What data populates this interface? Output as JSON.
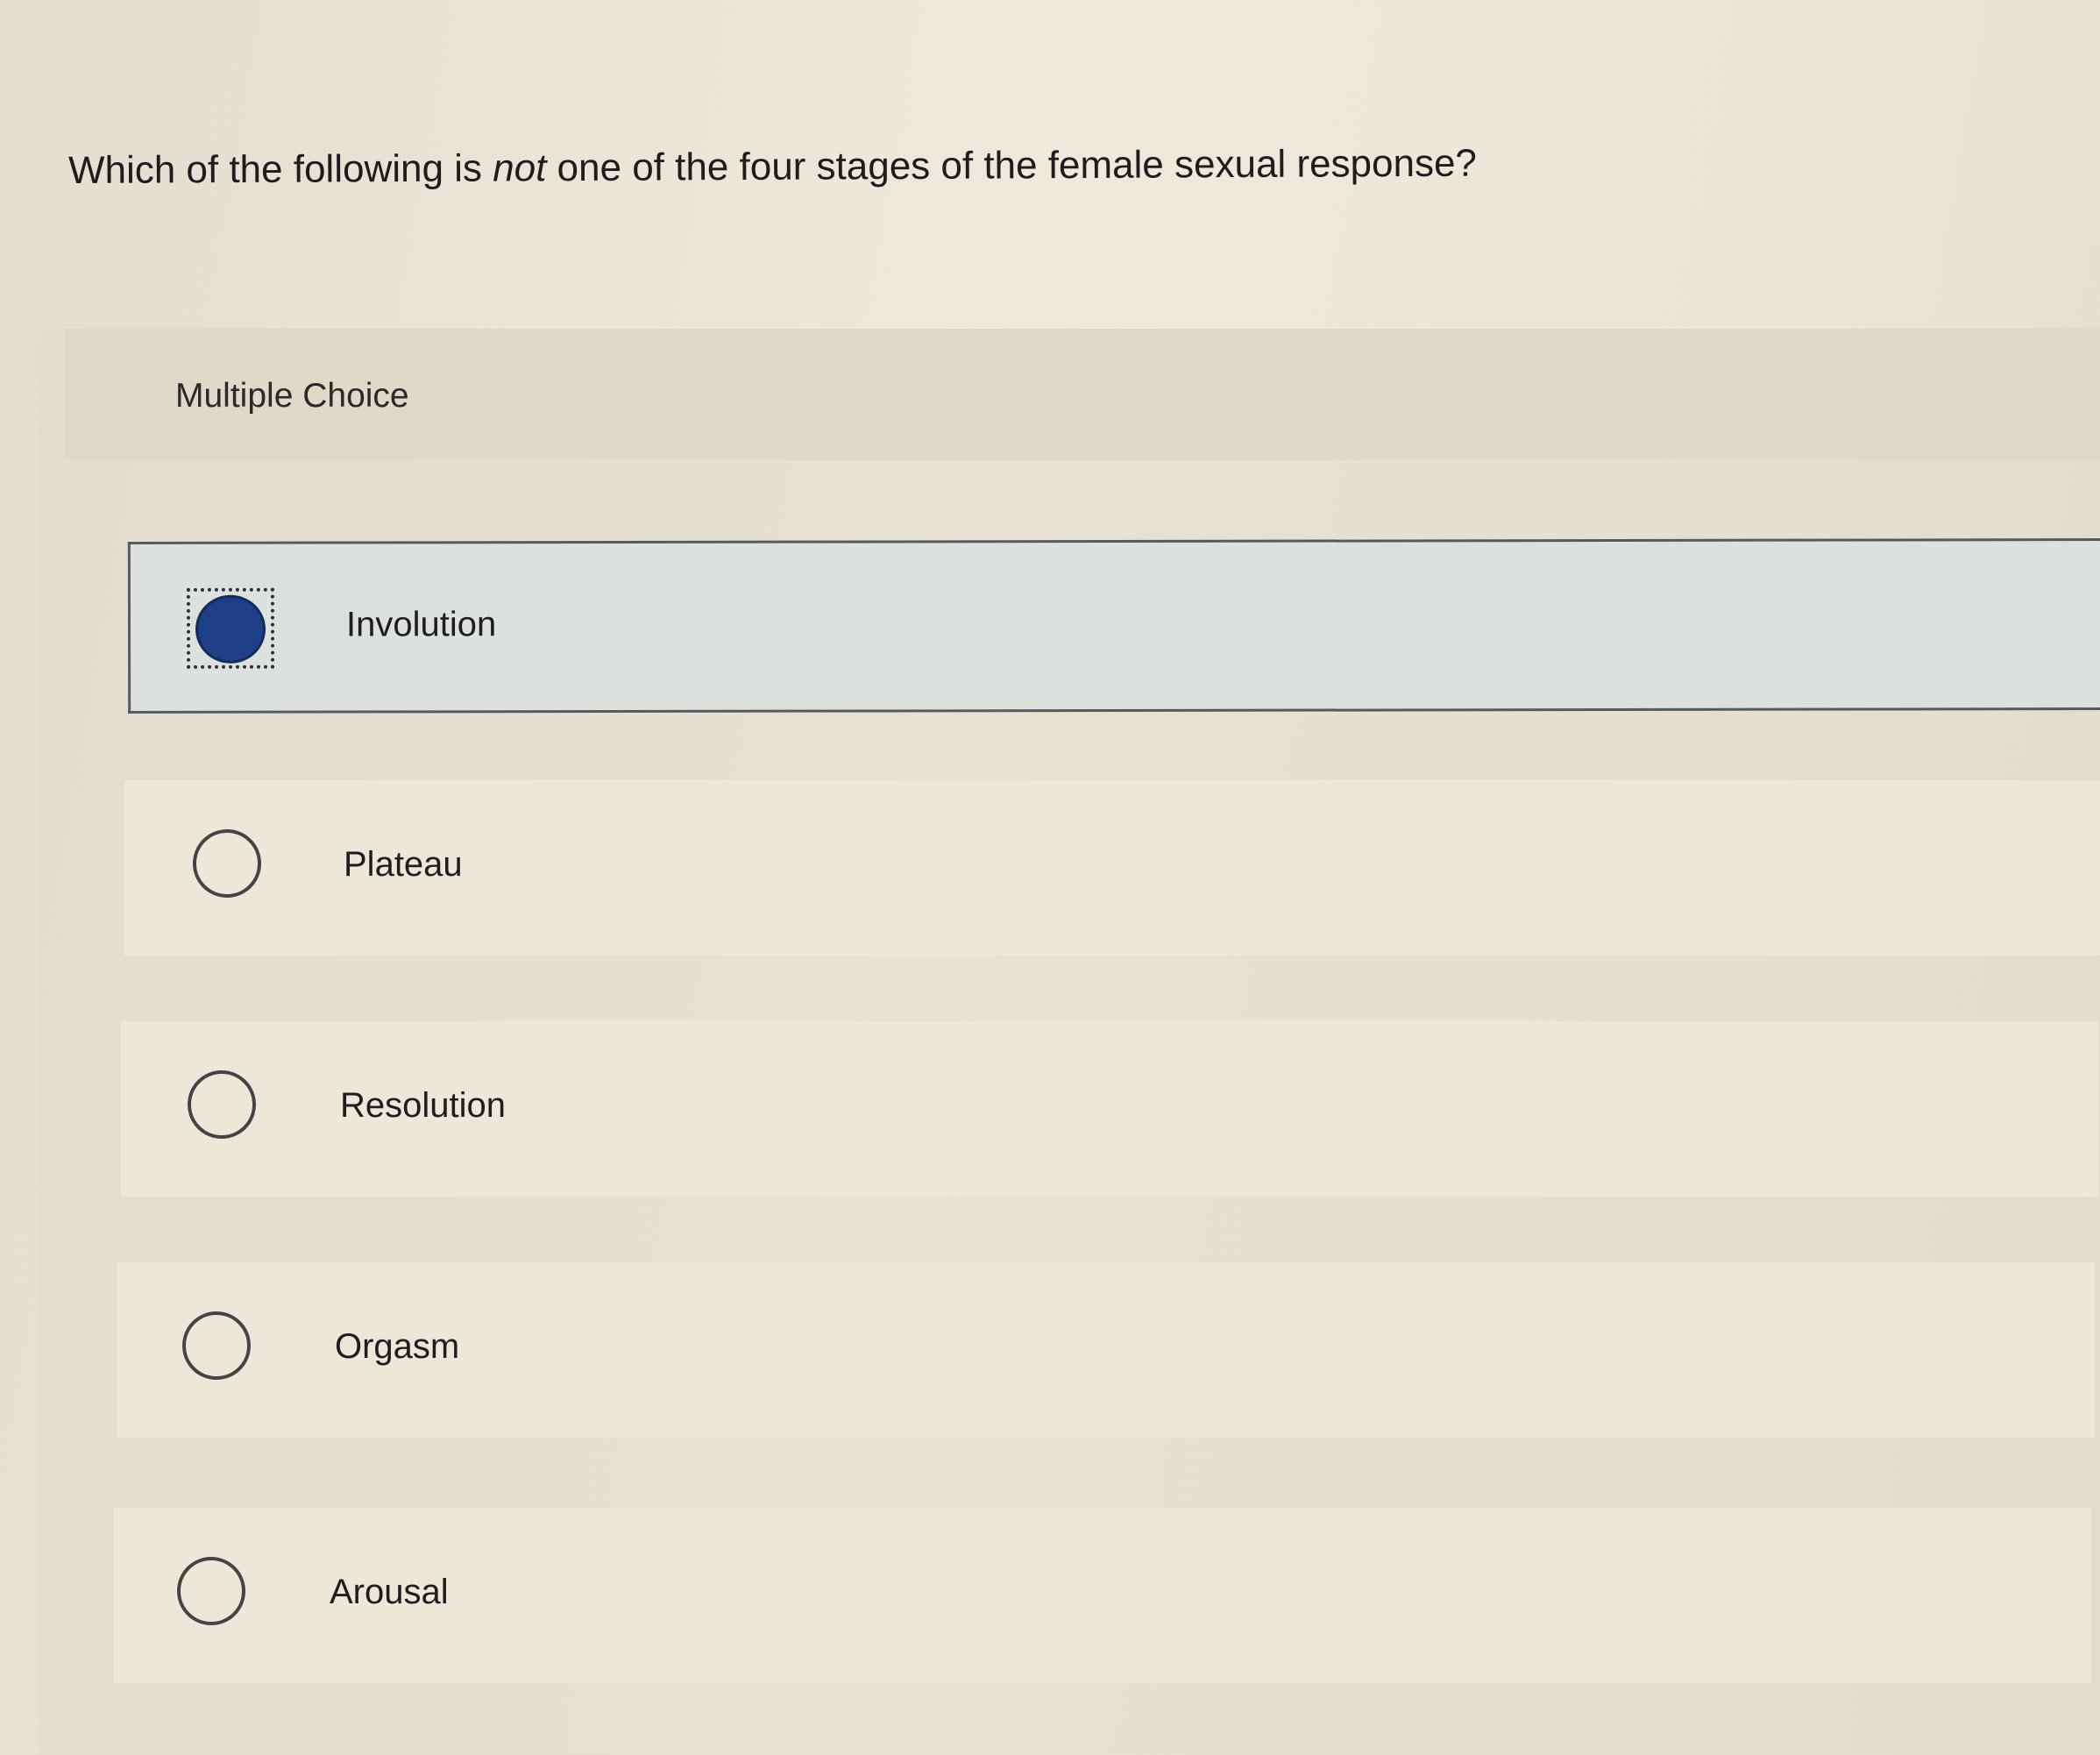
{
  "question": {
    "prefix": "Which of the following is ",
    "emphasis": "not",
    "suffix": " one of the four stages of the female sexual response?"
  },
  "section_label": "Multiple Choice",
  "options": [
    {
      "label": "Involution",
      "selected": true
    },
    {
      "label": "Plateau",
      "selected": false
    },
    {
      "label": "Resolution",
      "selected": false
    },
    {
      "label": "Orgasm",
      "selected": false
    },
    {
      "label": "Arousal",
      "selected": false
    }
  ],
  "colors": {
    "selected_radio": "#1f3f86",
    "selected_row": "#dde1dd"
  }
}
